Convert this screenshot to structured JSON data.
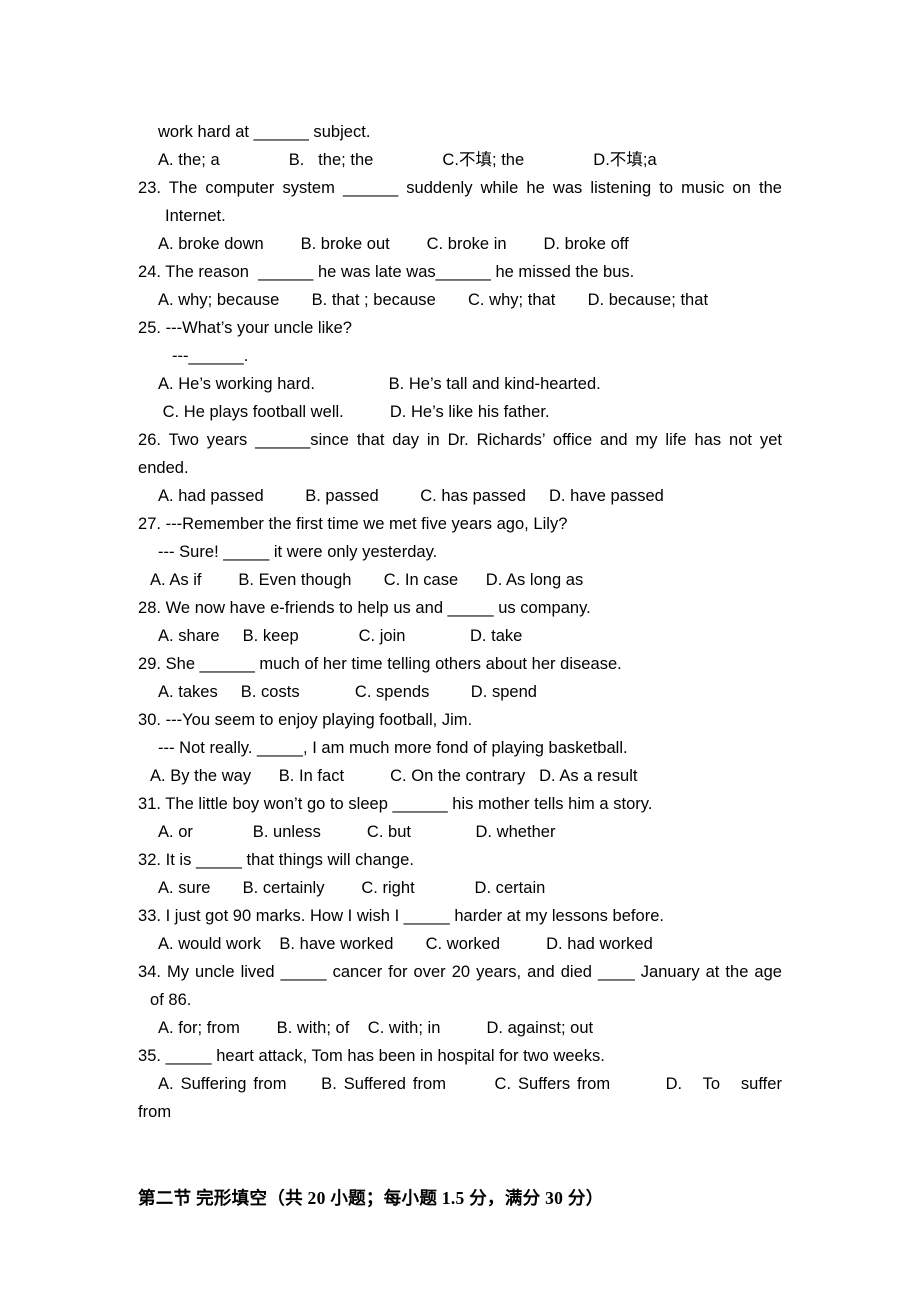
{
  "document": {
    "language": "en-zh",
    "page_background": "#ffffff",
    "text_color": "#000000"
  },
  "lines": {
    "q22_stem_cont": "work hard at ______ subject.",
    "q22_options": "A. the; a               B.   the; the               C.不填; the               D.不填;a",
    "q23_stem": "23. The computer system ______ suddenly while he was listening to music on the",
    "q23_stem_cont": "Internet.",
    "q23_options": "A. broke down        B. broke out        C. broke in        D. broke off",
    "q24_stem": "24. The reason  ______ he was late was______ he missed the bus.",
    "q24_options": "A. why; because       B. that ; because       C. why; that       D. because; that",
    "q25_stem": "25. ---What’s your uncle like?",
    "q25_answer_blank": "---______.",
    "q25_options_ab": "A. He’s working hard.                B. He’s tall and kind-hearted.",
    "q25_options_cd": " C. He plays football well.          D. He’s like his father.",
    "q26_stem": "26. Two years ______since that day in Dr. Richards’ office and my life has not yet",
    "q26_stem_cont": "ended.",
    "q26_options": "A. had passed         B. passed         C. has passed     D. have passed",
    "q27_stem": "27. ---Remember the first time we met five years ago, Lily?",
    "q27_stem_cont": "--- Sure! _____ it were only yesterday.",
    "q27_options": "A. As if        B. Even though       C. In case      D. As long as",
    "q28_stem": "28. We now have e-friends to help us and _____ us company.",
    "q28_options": "A. share     B. keep             C. join              D. take",
    "q29_stem": "29. She ______ much of her time telling others about her disease.",
    "q29_options": "A. takes     B. costs            C. spends         D. spend",
    "q30_stem": "30. ---You seem to enjoy playing football, Jim.",
    "q30_stem_cont": "--- Not really. _____, I am much more fond of playing basketball.",
    "q30_options": "A. By the way      B. In fact          C. On the contrary   D. As a result",
    "q31_stem": "31. The little boy won’t go to sleep ______ his mother tells him a story.",
    "q31_options": "A. or             B. unless          C. but              D. whether",
    "q32_stem": "32. It is _____ that things will change.",
    "q32_options": "A. sure       B. certainly        C. right             D. certain",
    "q33_stem": "33. I just got 90 marks. How I wish I _____ harder at my lessons before.",
    "q33_options": "A. would work    B. have worked       C. worked          D. had worked",
    "q34_stem": "34. My uncle lived _____ cancer for over 20 years, and died ____ January at the age",
    "q34_stem_cont": "of 86.",
    "q34_options": "A. for; from        B. with; of    C. with; in          D. against; out",
    "q35_stem": "35. _____ heart attack, Tom has been in hospital for two weeks.",
    "q35_options": "A. Suffering from     B. Suffered from       C. Suffers from        D.   To   suffer",
    "q35_options_cont": "from",
    "section_two_heading": "第二节 完形填空（共 20 小题；每小题 1.5 分，满分 30 分）"
  }
}
